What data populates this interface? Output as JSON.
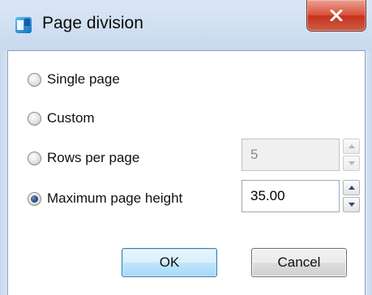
{
  "window": {
    "title": "Page division",
    "close_glyph": "X"
  },
  "options": [
    {
      "label": "Single page",
      "checked": false
    },
    {
      "label": "Custom",
      "checked": false
    },
    {
      "label": "Rows per page",
      "checked": false
    },
    {
      "label": "Maximum page height",
      "checked": true
    }
  ],
  "rows_per_page": {
    "value": "5",
    "enabled": false
  },
  "max_page_height": {
    "value": "35.00",
    "enabled": true
  },
  "buttons": {
    "ok": "OK",
    "cancel": "Cancel"
  },
  "colors": {
    "accent_blue": "#3c7fb1",
    "close_red": "#c7321d",
    "titlebar": "#c8d9ee"
  }
}
